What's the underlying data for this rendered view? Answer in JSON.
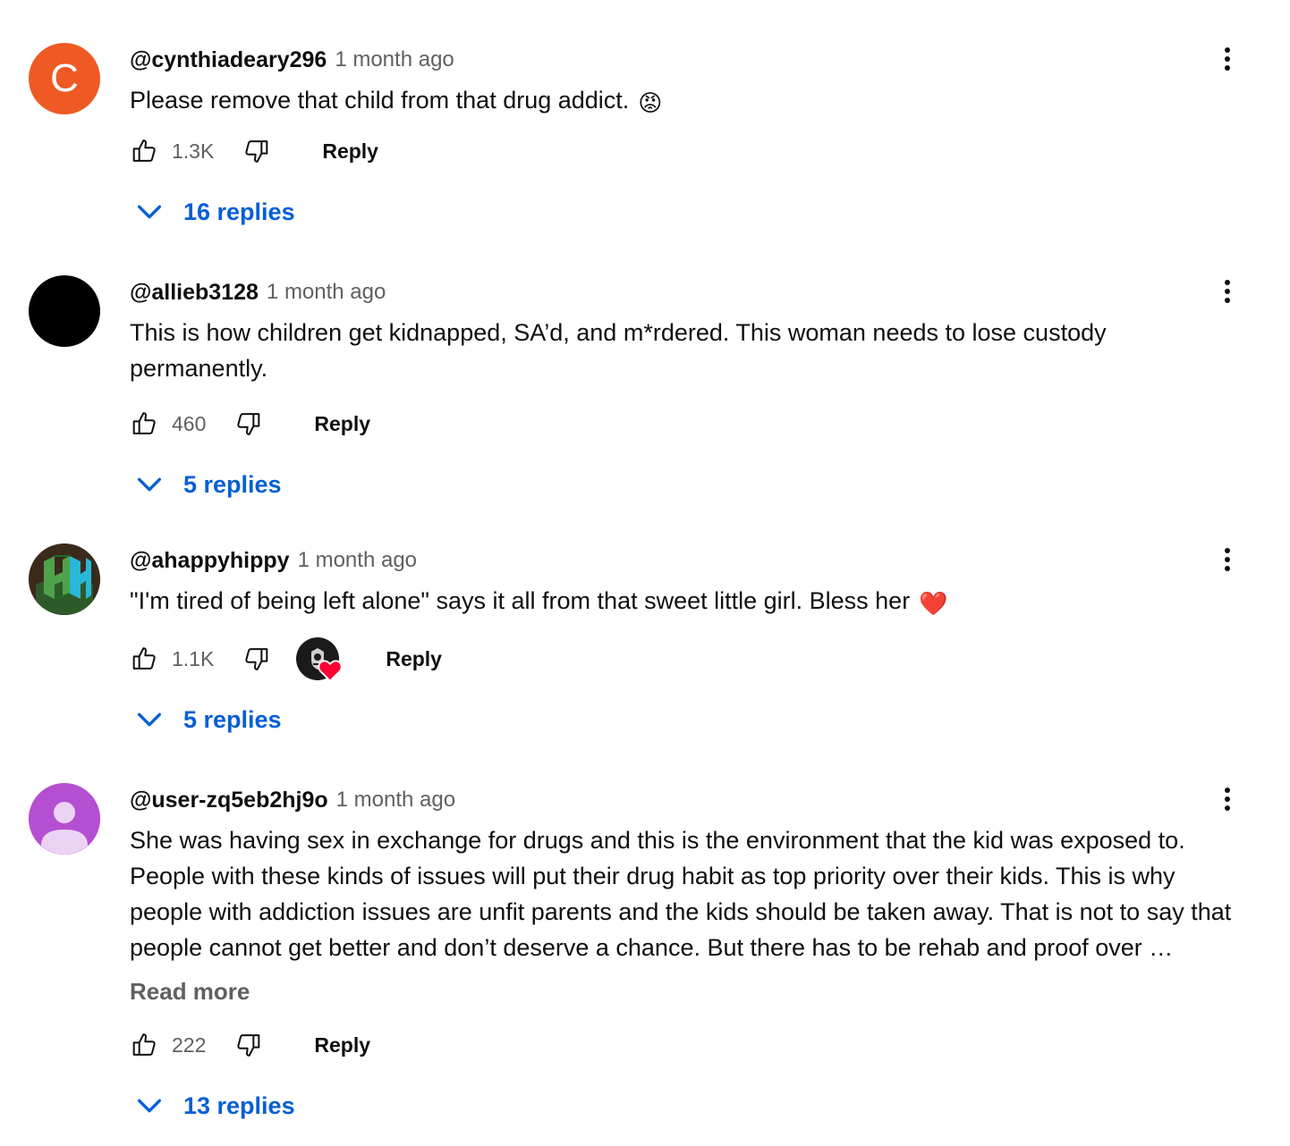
{
  "colors": {
    "link_blue": "#065fd4",
    "meta_gray": "#606060"
  },
  "comments": [
    {
      "author": "@cynthiadeary296",
      "time": "1 month ago",
      "text": "Please remove that child from that drug addict.",
      "emoji": "😡",
      "avatar": {
        "type": "letter",
        "letter": "C",
        "color": "#ef5a24"
      },
      "likes": "1.3K",
      "reply_label": "Reply",
      "replies_label": "16 replies"
    },
    {
      "author": "@allieb3128",
      "time": "1 month ago",
      "text": "This is how children get kidnapped, SA’d, and m*rdered. This woman needs to lose custody permanently.",
      "avatar": {
        "type": "image",
        "icon": "black-circle-avatar",
        "color": "#000000"
      },
      "likes": "460",
      "reply_label": "Reply",
      "replies_label": "5 replies"
    },
    {
      "author": "@ahappyhippy",
      "time": "1 month ago",
      "text": "\"I'm tired of being left alone\" says it all from that sweet little girl. Bless her",
      "emoji": "❤️",
      "avatar": {
        "type": "image",
        "icon": "hh-logo-avatar",
        "color": "#3a2a1c"
      },
      "likes": "1.1K",
      "creator_heart": {
        "icon": "creator-heart-icon",
        "color": "#ff0033"
      },
      "reply_label": "Reply",
      "replies_label": "5 replies"
    },
    {
      "author": "@user-zq5eb2hj9o",
      "time": "1 month ago",
      "text": "She was having sex in exchange for drugs and this is the environment that the kid was exposed to. People with these kinds of issues will put their drug habit as top priority over their kids. This is why people with addiction issues are unfit parents and the kids should be taken away. That is not to say that people cannot get better and don’t deserve a chance. But there has to be rehab and proof over …",
      "read_more": "Read more",
      "avatar": {
        "type": "default",
        "icon": "default-user-avatar",
        "color": "#b54fd1"
      },
      "likes": "222",
      "reply_label": "Reply",
      "replies_label": "13 replies"
    }
  ]
}
